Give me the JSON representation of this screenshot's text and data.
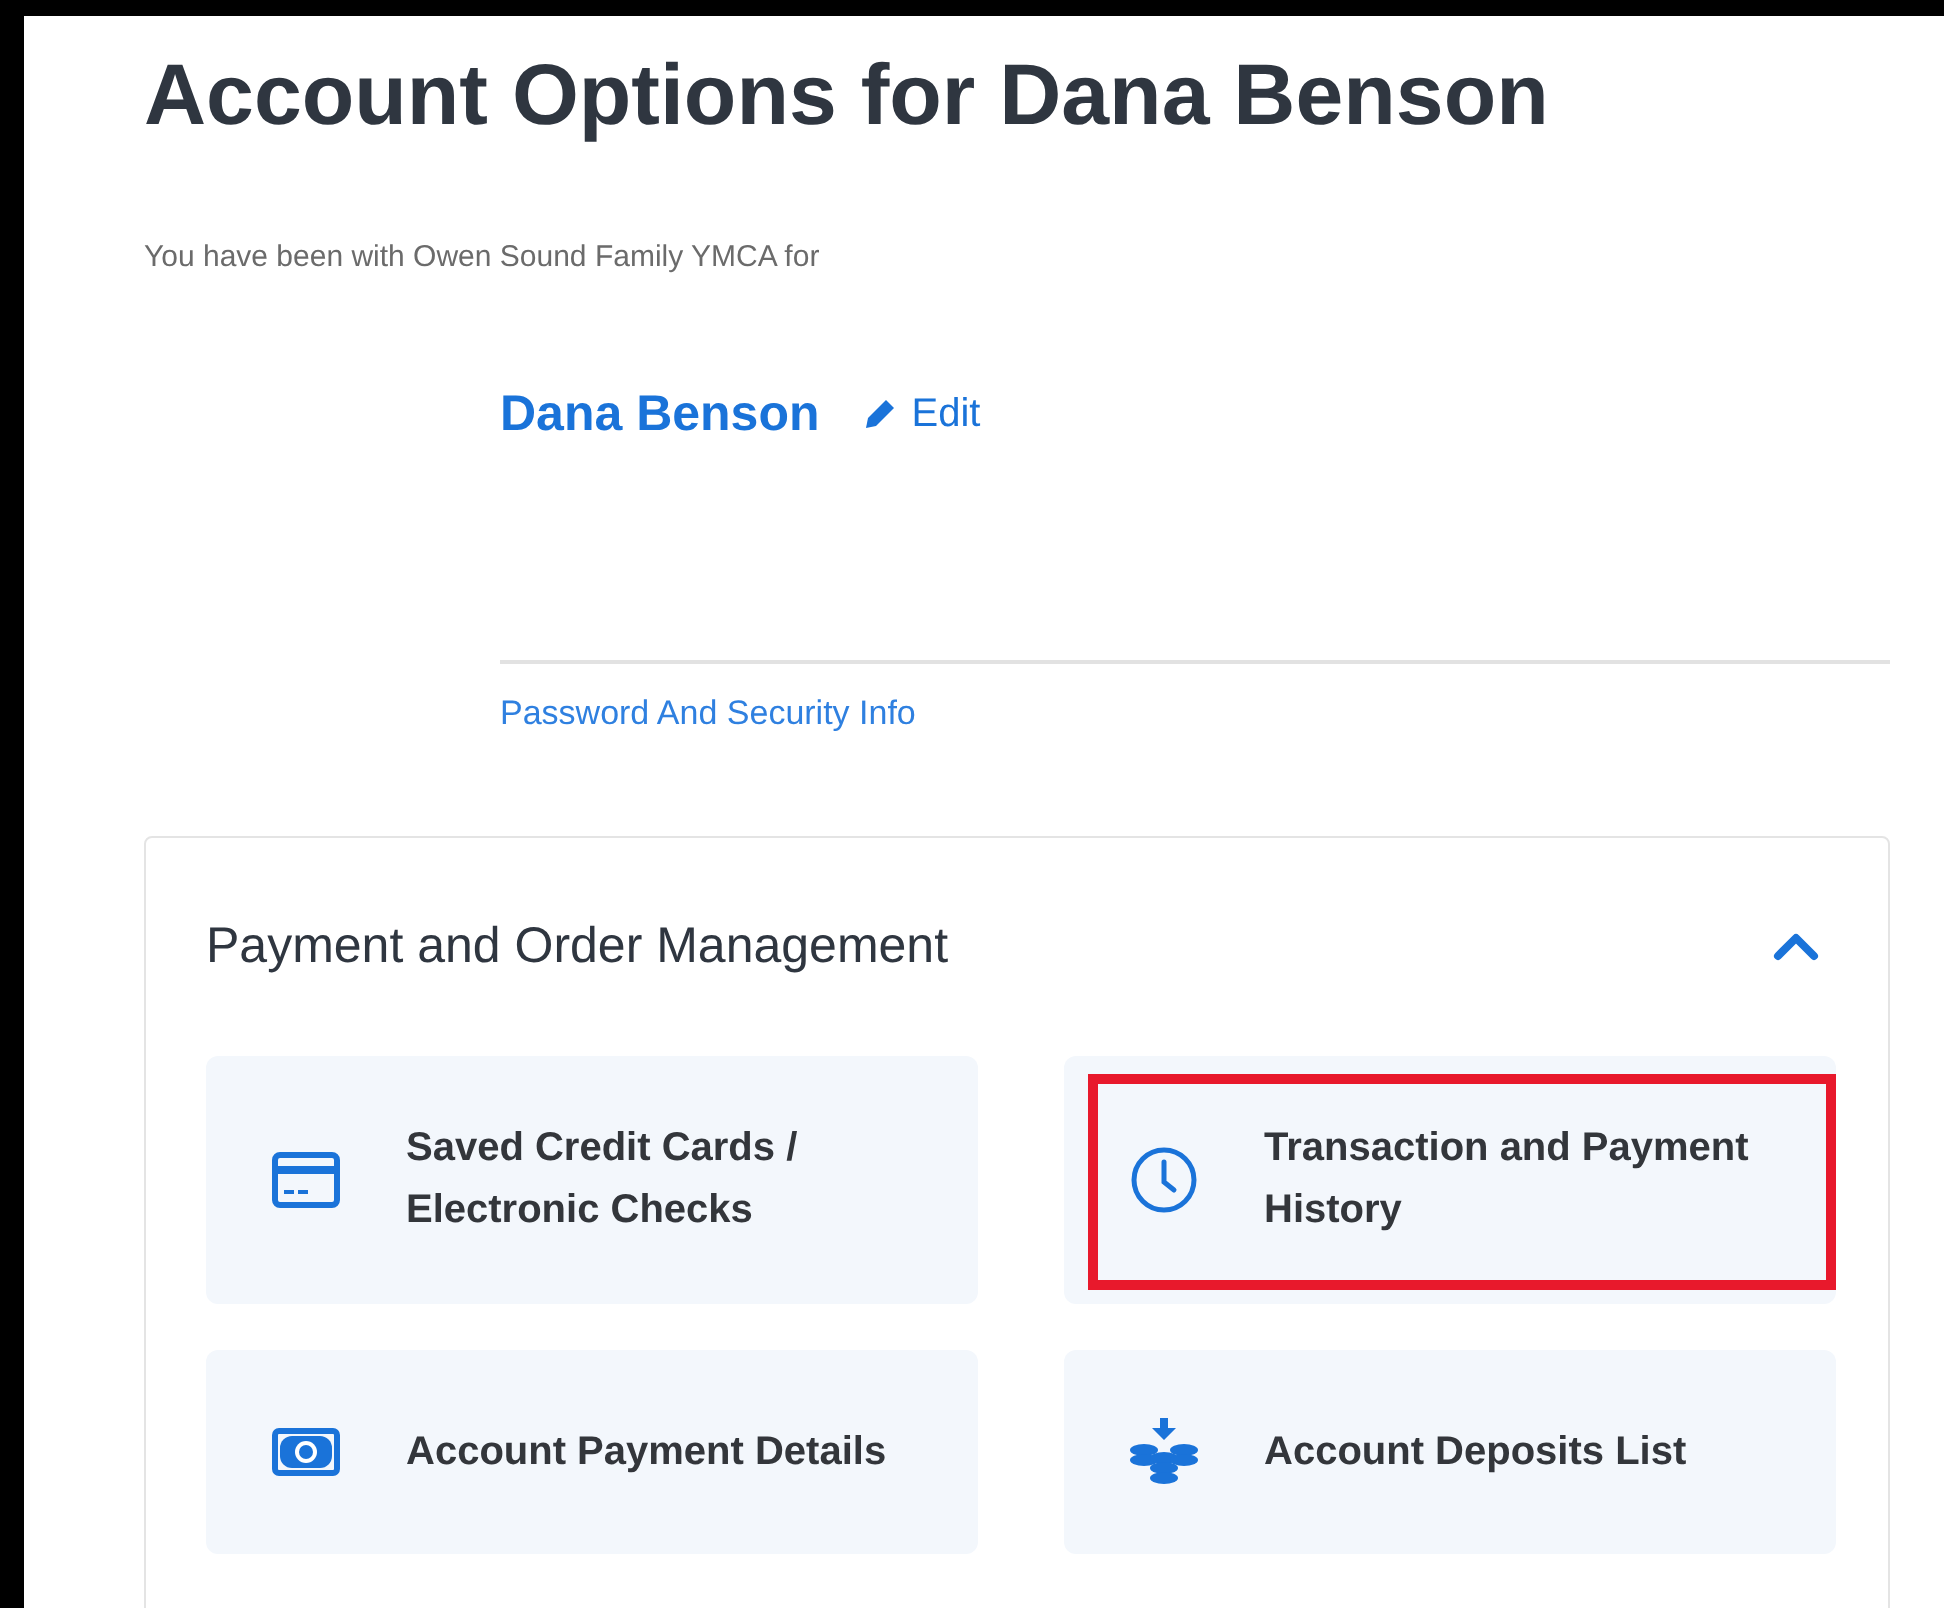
{
  "page": {
    "title": "Account Options for Dana Benson",
    "membership_note": "You have been with Owen Sound Family YMCA for"
  },
  "profile": {
    "name": "Dana Benson",
    "edit_link": "Edit",
    "security_link": "Password And Security Info"
  },
  "section": {
    "title": "Payment and Order Management",
    "expanded": true,
    "tiles": [
      {
        "kind": "card",
        "label": "Saved Credit Cards / Electronic Checks",
        "highlighted": false
      },
      {
        "kind": "clock",
        "label": "Transaction and Payment History",
        "highlighted": true
      },
      {
        "kind": "money",
        "label": "Account Payment Details",
        "highlighted": false
      },
      {
        "kind": "coins",
        "label": "Account Deposits List",
        "highlighted": false
      }
    ]
  }
}
